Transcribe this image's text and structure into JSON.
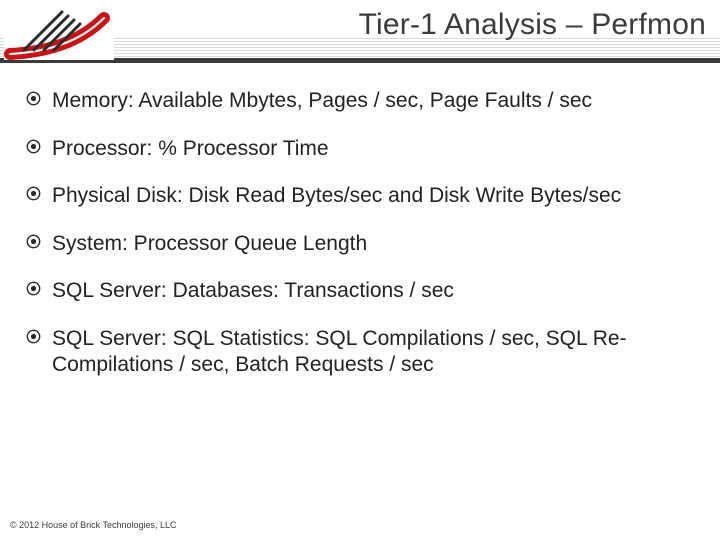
{
  "header": {
    "title": "Tier-1 Analysis – Perfmon"
  },
  "bullets": {
    "b0": "Memory: Available Mbytes, Pages / sec, Page Faults / sec",
    "b1": "Processor: % Processor Time",
    "b2": "Physical Disk: Disk Read Bytes/sec and Disk Write Bytes/sec",
    "b3": "System: Processor Queue Length",
    "b4": "SQL Server: Databases: Transactions / sec",
    "b5": "SQL Server: SQL Statistics: SQL Compilations / sec, SQL Re-Compilations / sec, Batch Requests / sec"
  },
  "footer": {
    "copyright": "© 2012 House of Brick Technologies, LLC"
  }
}
